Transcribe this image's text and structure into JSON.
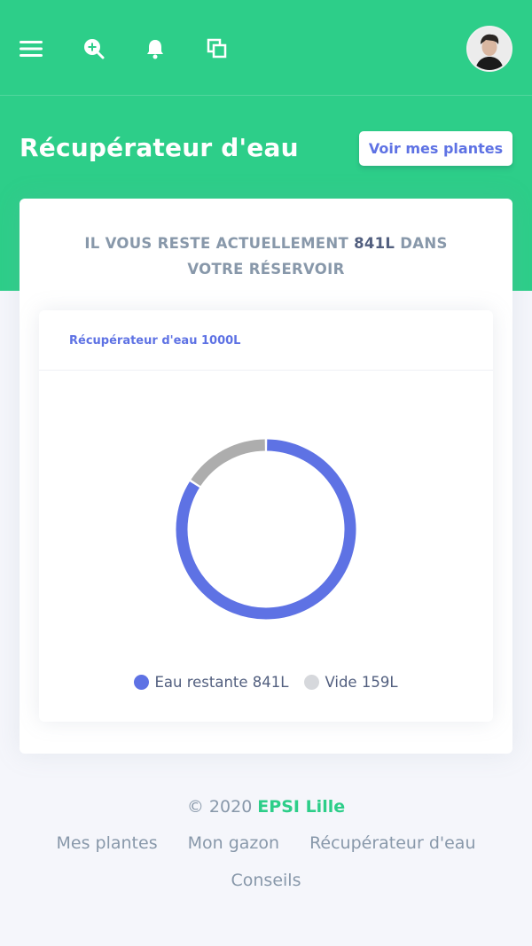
{
  "nav": {
    "icons": [
      "menu-icon",
      "search-plus-icon",
      "bell-icon",
      "copy-icon"
    ],
    "avatar": "user-avatar"
  },
  "header": {
    "title": "Récupérateur d'eau",
    "plants_button": "Voir mes plantes"
  },
  "summary": {
    "prefix": "IL VOUS RESTE ACTUELLEMENT",
    "amount": "841L",
    "suffix": "DANS VOTRE RÉSERVOIR"
  },
  "chart_card": {
    "title": "Récupérateur d'eau 1000L"
  },
  "chart_data": {
    "type": "pie",
    "title": "Récupérateur d'eau 1000L",
    "categories": [
      "Eau restante 841L",
      "Vide 159L"
    ],
    "values": [
      841,
      159
    ],
    "colors": [
      "#5e72e4",
      "#adadad"
    ],
    "legend_colors": [
      "#5e72e4",
      "#d6d8dc"
    ],
    "legend_position": "bottom"
  },
  "footer": {
    "copyright": "© 2020",
    "brand": "EPSI Lille",
    "links": [
      "Mes plantes",
      "Mon gazon",
      "Récupérateur d'eau",
      "Conseils"
    ]
  },
  "colors": {
    "primary_green": "#2dce89",
    "accent_blue": "#5e72e4",
    "muted_text": "#8898aa"
  }
}
